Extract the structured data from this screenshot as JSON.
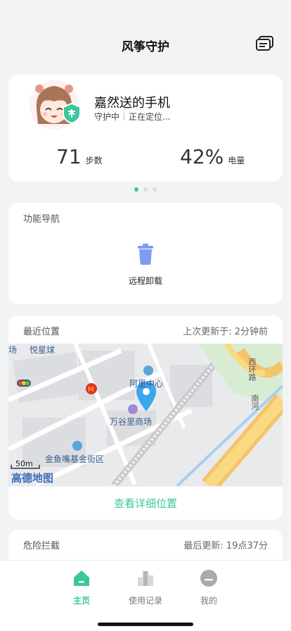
{
  "header": {
    "title": "风筝守护"
  },
  "profile": {
    "device_name": "嘉然送的手机",
    "status": "守护中",
    "location_status": "正在定位...",
    "steps": {
      "value": "71",
      "unit": "步数"
    },
    "battery": {
      "value": "42%",
      "unit": "电量"
    }
  },
  "pager": {
    "total": 3,
    "active": 0
  },
  "nav": {
    "title": "功能导航",
    "features": [
      {
        "label": "远程卸载",
        "icon": "trash-icon"
      }
    ]
  },
  "location": {
    "title": "最近位置",
    "updated": "上次更新于: 2分钟前",
    "map_labels": {
      "yuexingqiu": "悦星球",
      "chang": "场",
      "alibaba_center": "阿里中心",
      "wanguli": "万谷里商场",
      "jinyuzui": "金鱼嘴基金街区",
      "scale": "50m",
      "brand": "高德地图",
      "road1": "西环路",
      "road2": "南河"
    },
    "detail_button": "查看详细位置"
  },
  "danger": {
    "title": "危险拦截",
    "updated": "最后更新: 19点37分"
  },
  "tabbar": {
    "items": [
      {
        "label": "主页",
        "icon": "home-icon",
        "active": true
      },
      {
        "label": "使用记录",
        "icon": "usage-chart-icon",
        "active": false
      },
      {
        "label": "我的",
        "icon": "profile-icon",
        "active": false
      }
    ]
  },
  "colors": {
    "accent": "#3cc79a",
    "feature_icon": "#7f9cf5"
  }
}
